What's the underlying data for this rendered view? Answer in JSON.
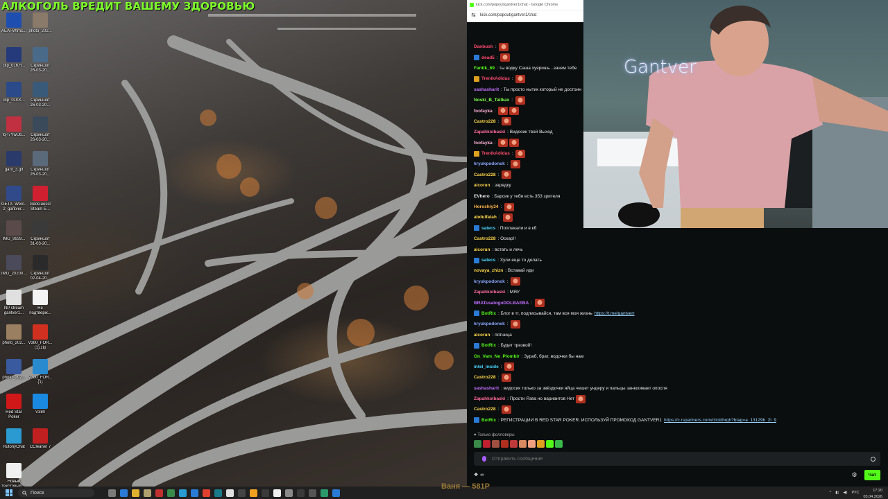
{
  "desktop": {
    "banner": "АЛКОГОЛЬ ВРЕДИТ ВАШЕМУ ЗДОРОВЬЮ",
    "icons": [
      {
        "label": "AEAFWtmc...",
        "name": "file-icon-aeafw",
        "color": "#1e4fb0"
      },
      {
        "label": "photo_202...",
        "name": "photo-icon",
        "color": "#8a7a6a"
      },
      {
        "label": "clip_01KH...",
        "name": "clip-icon",
        "color": "#243a7a"
      },
      {
        "label": "Скриншот\n26-03-20...",
        "name": "screenshot-icon",
        "color": "#4a6a8a"
      },
      {
        "label": "clip_01KK...",
        "name": "clip-icon",
        "color": "#2a4a8a"
      },
      {
        "label": "Скриншот\n26-03-20...",
        "name": "screenshot-icon",
        "color": "#3a5a7a"
      },
      {
        "label": "fq-f7YwUb...",
        "name": "image-icon",
        "color": "#c03040"
      },
      {
        "label": "Скриншот\n26-03-20...",
        "name": "screenshot-icon",
        "color": "#3a4a5a"
      },
      {
        "label": "gant_3.gif",
        "name": "gif-icon",
        "color": "#2a3a6a"
      },
      {
        "label": "Скриншот\n26-03-20...",
        "name": "screenshot-icon",
        "color": "#5a6a7a"
      },
      {
        "label": "GETA_Welc...\n2_gantver...",
        "name": "image-icon",
        "color": "#304a8a"
      },
      {
        "label": "GeoGuessr\nSteam E...",
        "name": "geoguessr-icon",
        "color": "#d02030"
      },
      {
        "label": "IMG_9939...",
        "name": "image-icon",
        "color": "#5a4a4a"
      },
      {
        "label": "Скриншот\n31-03-20...",
        "name": "screenshot-icon",
        "color": "#3a3a3a"
      },
      {
        "label": "IMG_20200...",
        "name": "image-icon",
        "color": "#4a4a5a"
      },
      {
        "label": "Скриншот\n02-04-20...",
        "name": "screenshot-icon",
        "color": "#2a2a2a"
      },
      {
        "label": "NP stream\ngantver1...",
        "name": "file-icon",
        "color": "#e0e0e0"
      },
      {
        "label": "Не\nподтверж...",
        "name": "file-icon",
        "color": "#f4f4f4"
      },
      {
        "label": "photo_202...",
        "name": "photo-icon",
        "color": "#9a8060"
      },
      {
        "label": "V380_FOR...\n(1).zip",
        "name": "zip-icon",
        "color": "#d03020"
      },
      {
        "label": "photo_202...",
        "name": "photo-icon",
        "color": "#3a5aa0"
      },
      {
        "label": "V380_FOR...\n(1)",
        "name": "file-icon",
        "color": "#2a8ad0"
      },
      {
        "label": "Red Star\nPoker",
        "name": "red-star-poker-icon",
        "color": "#d01818"
      },
      {
        "label": "V380",
        "name": "v380-icon",
        "color": "#1a8ae0"
      },
      {
        "label": "RutonyChat",
        "name": "rutonychat-icon",
        "color": "#2a9ad0"
      },
      {
        "label": "CCleaner 7",
        "name": "ccleaner-icon",
        "color": "#c02020"
      },
      {
        "label": "Новый\nтекстовый ...",
        "name": "text-file-icon",
        "color": "#f0f0f0"
      }
    ]
  },
  "popup": {
    "title": "kick.com/popout/gantver1/chat - Google Chrome",
    "url": "kick.com/popout/gantver1/chat"
  },
  "chat": {
    "messages": [
      {
        "user": "Danbush",
        "color": "#ff4b6e",
        "badge": "",
        "text": "",
        "emotes": 1
      },
      {
        "user": "dead5",
        "color": "#ff4b6e",
        "badge": "#2a7bd5",
        "text": "",
        "emotes": 1
      },
      {
        "user": "Fantik_69",
        "color": "#53fc18",
        "badge": "",
        "text": "ты водку Саша хуяришь ..зачем тебе",
        "emotes": 0
      },
      {
        "user": "TrenikAdidas",
        "color": "#ff4b6e",
        "badge": "#e0a020",
        "text": "",
        "emotes": 1
      },
      {
        "user": "sashasharit",
        "color": "#c270ff",
        "badge": "",
        "text": "Ты просто нытик который не достоин",
        "emotes": 0
      },
      {
        "user": "Noski_B_Tallkax",
        "color": "#7dff4a",
        "badge": "",
        "text": "",
        "emotes": 1
      },
      {
        "user": "foofayka",
        "color": "#ffb3d9",
        "badge": "",
        "text": "",
        "emotes": 2
      },
      {
        "user": "Castro228",
        "color": "#ffd84a",
        "badge": "",
        "text": "",
        "emotes": 1
      },
      {
        "user": "Zapahkolbaski",
        "color": "#ff6b9a",
        "badge": "",
        "text": "Видосик твой Выход",
        "emotes": 0
      },
      {
        "user": "foofayka",
        "color": "#ffb3d9",
        "badge": "",
        "text": "",
        "emotes": 2
      },
      {
        "user": "TrenikAdidas",
        "color": "#ff4b6e",
        "badge": "#e0a020",
        "text": "",
        "emotes": 1
      },
      {
        "user": "kryukpodonok",
        "color": "#8aa8ff",
        "badge": "",
        "text": "",
        "emotes": 1
      },
      {
        "user": "Castro228",
        "color": "#ffd84a",
        "badge": "",
        "text": "",
        "emotes": 1
      },
      {
        "user": "alcorun",
        "color": "#ffd84a",
        "badge": "",
        "text": "зарядку",
        "emotes": 0
      },
      {
        "user": "EVhero",
        "color": "#e8e8e8",
        "badge": "",
        "text": "Барсик у тебя есть 353 зрителя",
        "emotes": 0
      },
      {
        "user": "Horoshiy34",
        "color": "#ffb84a",
        "badge": "",
        "text": "",
        "emotes": 1
      },
      {
        "user": "abdulfatah",
        "color": "#ffd84a",
        "badge": "",
        "text": "",
        "emotes": 1
      },
      {
        "user": "satecs",
        "color": "#4ad8ff",
        "badge": "#2a7bd5",
        "text": "Поплакали и в кб",
        "emotes": 0
      },
      {
        "user": "Castro228",
        "color": "#ffd84a",
        "badge": "",
        "text": "Оскар!!",
        "emotes": 0
      },
      {
        "user": "alcorun",
        "color": "#ffd84a",
        "badge": "",
        "text": "встать и лечь",
        "emotes": 0
      },
      {
        "user": "satecs",
        "color": "#4ad8ff",
        "badge": "#2a7bd5",
        "text": "Хули еще то делать",
        "emotes": 0
      },
      {
        "user": "novaya_zhizn",
        "color": "#ffd84a",
        "badge": "",
        "text": "Вставай иди",
        "emotes": 0
      },
      {
        "user": "kryukpodonok",
        "color": "#8aa8ff",
        "badge": "",
        "text": "",
        "emotes": 1
      },
      {
        "user": "Zapahkolbaski",
        "color": "#ff6b9a",
        "badge": "",
        "text": "МЯУ",
        "emotes": 0
      },
      {
        "user": "BRATusatogoDOLBAEBA",
        "color": "#c270ff",
        "badge": "",
        "text": "",
        "emotes": 1
      },
      {
        "user": "BotRix",
        "color": "#53fc18",
        "badge": "#2a7bd5",
        "text": "Блог в тг, подписывайся, там вся моя жизнь",
        "link": "https://t.me/gantverr",
        "emotes": 0
      },
      {
        "user": "kryukpodonok",
        "color": "#8aa8ff",
        "badge": "",
        "text": "",
        "emotes": 1
      },
      {
        "user": "alcorun",
        "color": "#ffd84a",
        "badge": "",
        "text": "пятница",
        "emotes": 0
      },
      {
        "user": "BotRix",
        "color": "#53fc18",
        "badge": "#2a7bd5",
        "text": "Будет трезвой!",
        "emotes": 0
      },
      {
        "user": "On_Vam_Ne_Plombir",
        "color": "#53fc18",
        "badge": "",
        "text": "Зураб, брат, водочки бы нам",
        "emotes": 0
      },
      {
        "user": "intel_inside",
        "color": "#4ad8ff",
        "badge": "",
        "text": "",
        "emotes": 1
      },
      {
        "user": "Castro228",
        "color": "#ffd84a",
        "badge": "",
        "text": "",
        "emotes": 1
      },
      {
        "user": "sashasharit",
        "color": "#c270ff",
        "badge": "",
        "text": "видосик только за звёздочки яйца чешет ундеру и пальцы занюхивает опосля",
        "emotes": 0
      },
      {
        "user": "Zapahkolbaski",
        "color": "#ff6b9a",
        "badge": "",
        "text": "Прости Язва но вариантов Нет",
        "emotes": 1
      },
      {
        "user": "Castro228",
        "color": "#ffd84a",
        "badge": "",
        "text": "",
        "emotes": 1
      },
      {
        "user": "BotRix",
        "color": "#53fc18",
        "badge": "#2a7bd5",
        "text": "РЕГИСТРАЦИИ В RED STAR POKER. ИСПОЛЬЗУЙ ПРОМОКОД GANTVER1",
        "link": "https://c.rspartners.com/clickthrgh?btag=a_13129b_2l_9",
        "emotes": 0
      }
    ],
    "followers_only": "Только фолловеры",
    "input_placeholder": "Отправить сообщение",
    "points": "∞",
    "send_label": "Чат"
  },
  "webcam": {
    "sign": "Gantver"
  },
  "taskbar": {
    "search_label": "Поиск",
    "overlay_text": "Ваня — 581Р",
    "lang": "РУС",
    "time": "17:20",
    "date": "03.04.2026"
  }
}
